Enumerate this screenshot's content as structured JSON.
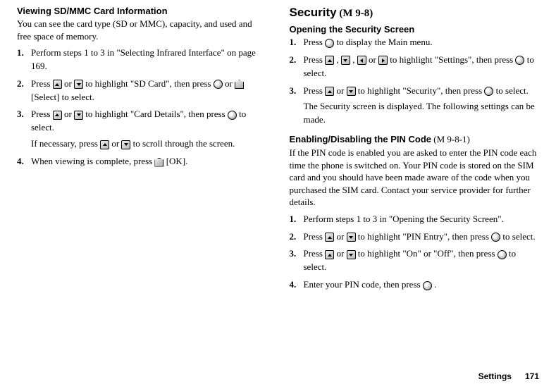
{
  "left": {
    "heading": "Viewing SD/MMC Card Information",
    "intro": "You can see the card type (SD or MMC), capacity, and used and free space of memory.",
    "steps": {
      "s1": {
        "num": "1.",
        "text": "Perform steps 1 to 3 in \"Selecting Infrared Interface\" on page 169."
      },
      "s2": {
        "num": "2.",
        "t1": "Press ",
        "t2": " or ",
        "t3": " to highlight \"SD Card\", then press ",
        "t4": " or ",
        "t5": " [Select] to select."
      },
      "s3": {
        "num": "3.",
        "t1": "Press ",
        "t2": " or ",
        "t3": " to highlight \"Card Details\", then press ",
        "t4": " to select.",
        "extra1": "If necessary, press ",
        "extra2": " or ",
        "extra3": " to scroll through the screen."
      },
      "s4": {
        "num": "4.",
        "t1": "When viewing is complete, press ",
        "t2": " [OK]."
      }
    }
  },
  "right": {
    "security_heading": "Security",
    "security_code": " (M 9-8)",
    "opening_heading": "Opening the Security Screen",
    "opening_steps": {
      "s1": {
        "num": "1.",
        "t1": "Press ",
        "t2": " to display the Main menu."
      },
      "s2": {
        "num": "2.",
        "t1": "Press ",
        "t2": ", ",
        "t3": ", ",
        "t4": " or ",
        "t5": " to highlight \"Settings\", then press ",
        "t6": " to select."
      },
      "s3": {
        "num": "3.",
        "t1": "Press ",
        "t2": " or ",
        "t3": " to highlight \"Security\", then press ",
        "t4": " to select.",
        "extra": "The Security screen is displayed. The following settings can be made."
      }
    },
    "pin_heading": "Enabling/Disabling the PIN Code",
    "pin_code": " (M 9-8-1)",
    "pin_intro": "If the PIN code is enabled you are asked to enter the PIN code each time the phone is switched on. Your PIN code is stored on the SIM card and you should have been made aware of the code when you purchased the SIM card. Contact your service provider for further details.",
    "pin_steps": {
      "s1": {
        "num": "1.",
        "text": "Perform steps 1 to 3 in \"Opening the Security Screen\"."
      },
      "s2": {
        "num": "2.",
        "t1": "Press ",
        "t2": " or ",
        "t3": " to highlight \"PIN Entry\", then press ",
        "t4": " to select."
      },
      "s3": {
        "num": "3.",
        "t1": "Press ",
        "t2": " or ",
        "t3": " to highlight \"On\" or \"Off\", then press ",
        "t4": " to select."
      },
      "s4": {
        "num": "4.",
        "t1": "Enter your PIN code, then press ",
        "t2": "."
      }
    }
  },
  "footer": {
    "label": "Settings",
    "page": "171"
  }
}
